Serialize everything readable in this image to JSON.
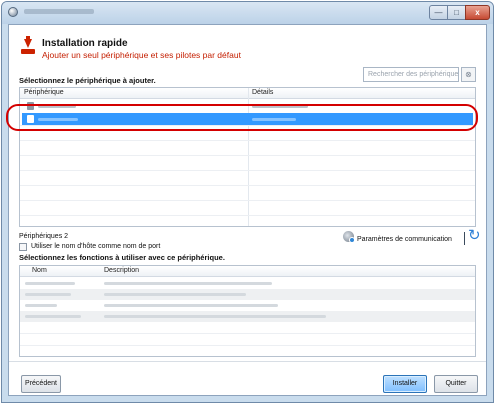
{
  "window": {
    "controls": {
      "minimize": "—",
      "maximize": "□",
      "close": "x"
    }
  },
  "header": {
    "title": "Installation rapide",
    "subtitle": "Ajouter un seul périphérique et ses pilotes par défaut",
    "icon": "install-arrow-icon"
  },
  "device_section": {
    "label": "Sélectionnez le périphérique à ajouter.",
    "search_placeholder": "Rechercher des périphériques",
    "search_button_icon": "search-clear-icon",
    "search_button_glyph": "⊗",
    "columns": [
      "Périphérique",
      "Détails"
    ],
    "selected_row_index": 1
  },
  "device_count": "Périphériques 2",
  "hostname_option": {
    "label": "Utiliser le nom d'hôte comme nom de port",
    "checked": false
  },
  "communication": {
    "label": "Paramètres de communication",
    "icon": "communication-settings-icon",
    "refresh_icon": "refresh-icon",
    "refresh_glyph": "↻"
  },
  "functions_section": {
    "label": "Sélectionnez les fonctions à utiliser avec ce périphérique.",
    "columns": [
      "Nom",
      "Description"
    ]
  },
  "buttons": {
    "previous": "Précédent",
    "install": "Installer",
    "quit": "Quitter"
  },
  "colors": {
    "accent_red": "#c41e00",
    "selection_blue": "#3399ff",
    "highlight_ring": "#d40000",
    "refresh_blue": "#2d7fd6"
  }
}
